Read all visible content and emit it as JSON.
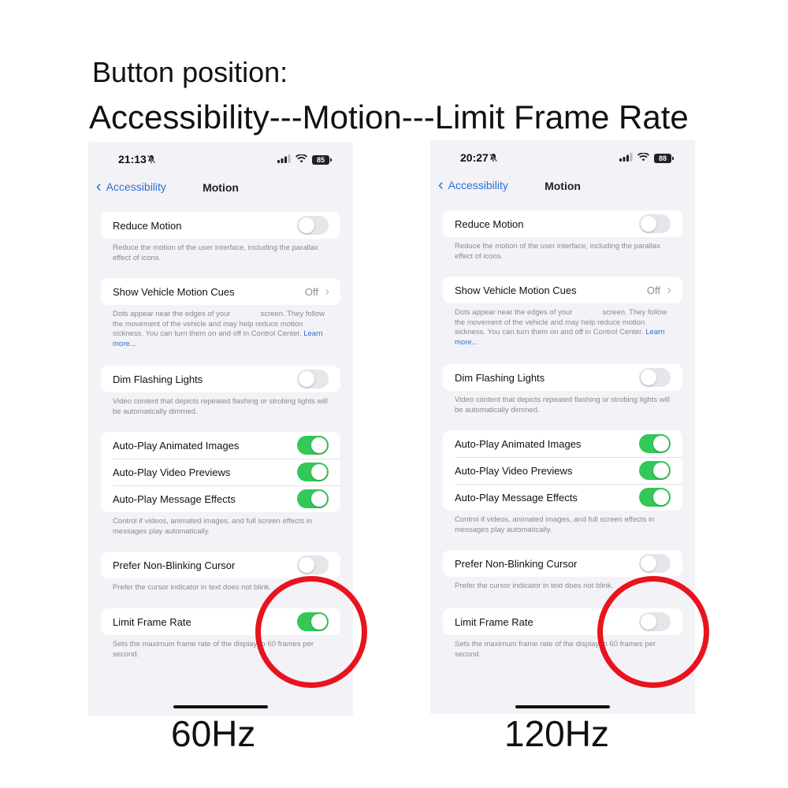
{
  "heading": {
    "line1": "Button position:",
    "line2": "Accessibility---Motion---Limit Frame Rate"
  },
  "icons": {
    "bell": "bell-slash-icon",
    "signal": "cellular-signal-icon",
    "wifi": "wifi-icon",
    "battery": "battery-icon",
    "back": "chevron-left-icon",
    "disclosure": "chevron-right-icon"
  },
  "colors": {
    "toggle_on": "#34c759",
    "toggle_off": "#e5e5ea",
    "link": "#2f6fd6",
    "highlight_circle": "#e8141d"
  },
  "screens": [
    {
      "caption": "60Hz",
      "status": {
        "time": "21:13",
        "battery": "85"
      },
      "nav": {
        "back": "Accessibility",
        "title": "Motion"
      },
      "reduce_motion": {
        "label": "Reduce Motion",
        "on": false
      },
      "reduce_motion_note": "Reduce the motion of the user interface, including the parallax effect of icons.",
      "vehicle": {
        "label": "Show Vehicle Motion Cues",
        "value": "Off"
      },
      "vehicle_note_a": "Dots appear near the edges of your",
      "vehicle_note_b": "screen. They follow the movement of the vehicle and may help reduce motion sickness. You can turn them on and off in Control Center.",
      "vehicle_link": "Learn more...",
      "dim_flashing": {
        "label": "Dim Flashing Lights",
        "on": false
      },
      "dim_note": "Video content that depicts repeated flashing or strobing lights will be automatically dimmed.",
      "autoplay_images": {
        "label": "Auto-Play Animated Images",
        "on": true
      },
      "autoplay_video": {
        "label": "Auto-Play Video Previews",
        "on": true
      },
      "autoplay_message": {
        "label": "Auto-Play Message Effects",
        "on": true
      },
      "autoplay_note": "Control if videos, animated images, and full screen effects in messages play automatically.",
      "cursor": {
        "label": "Prefer Non-Blinking Cursor",
        "on": false
      },
      "cursor_note": "Prefer the cursor indicator in text does not blink.",
      "frame_rate": {
        "label": "Limit Frame Rate",
        "on": true
      },
      "frame_note": "Sets the maximum frame rate of the display to 60 frames per second."
    },
    {
      "caption": "120Hz",
      "status": {
        "time": "20:27",
        "battery": "88"
      },
      "nav": {
        "back": "Accessibility",
        "title": "Motion"
      },
      "reduce_motion": {
        "label": "Reduce Motion",
        "on": false
      },
      "reduce_motion_note": "Reduce the motion of the user interface, including the parallax effect of icons.",
      "vehicle": {
        "label": "Show Vehicle Motion Cues",
        "value": "Off"
      },
      "vehicle_note_a": "Dots appear near the edges of your",
      "vehicle_note_b": "screen. They follow the movement of the vehicle and may help reduce motion sickness. You can turn them on and off in Control Center.",
      "vehicle_link": "Learn more...",
      "dim_flashing": {
        "label": "Dim Flashing Lights",
        "on": false
      },
      "dim_note": "Video content that depicts repeated flashing or strobing lights will be automatically dimmed.",
      "autoplay_images": {
        "label": "Auto-Play Animated Images",
        "on": true
      },
      "autoplay_video": {
        "label": "Auto-Play Video Previews",
        "on": true
      },
      "autoplay_message": {
        "label": "Auto-Play Message Effects",
        "on": true
      },
      "autoplay_note": "Control if videos, animated images, and full screen effects in messages play automatically.",
      "cursor": {
        "label": "Prefer Non-Blinking Cursor",
        "on": false
      },
      "cursor_note": "Prefer the cursor indicator in text does not blink.",
      "frame_rate": {
        "label": "Limit Frame Rate",
        "on": false
      },
      "frame_note": "Sets the maximum frame rate of the display to 60 frames per second."
    }
  ]
}
